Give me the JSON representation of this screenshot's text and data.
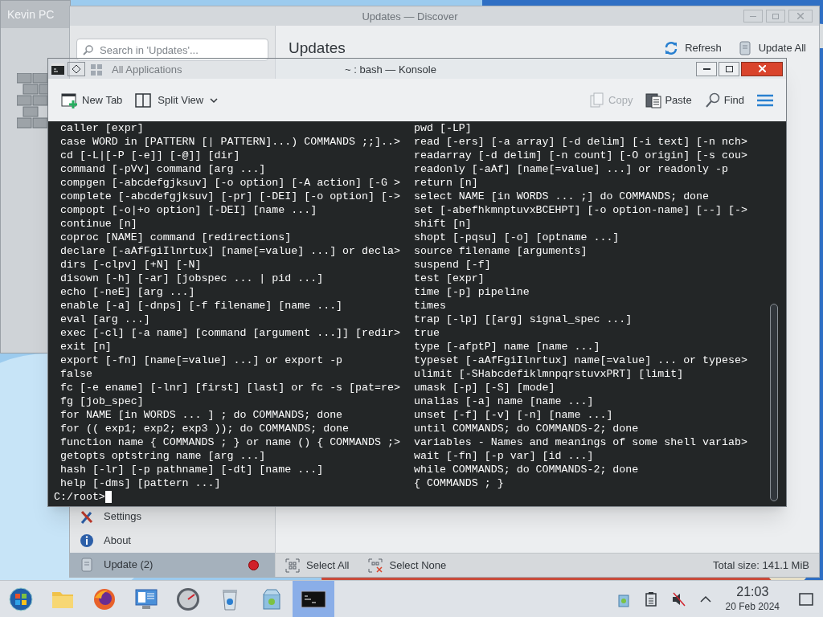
{
  "background_window": {
    "title": "Kevin PC"
  },
  "discover": {
    "title": "Updates — Discover",
    "search": {
      "placeholder": "Search in 'Updates'..."
    },
    "heading": "Updates",
    "actions": [
      {
        "kind": "refresh",
        "label": "Refresh"
      },
      {
        "kind": "update",
        "label": "Update All"
      }
    ],
    "sidebar": {
      "top_items": [
        {
          "kind": "apps",
          "label": "All Applications",
          "selected": false
        }
      ],
      "bottom_items": [
        {
          "kind": "settings",
          "label": "Settings",
          "selected": false
        },
        {
          "kind": "about",
          "label": "About",
          "selected": false
        },
        {
          "kind": "update",
          "label": "Update (2)",
          "selected": true,
          "alert": true
        }
      ]
    },
    "footer": {
      "buttons": [
        {
          "kind": "select-all",
          "label": "Select All"
        },
        {
          "kind": "select-none",
          "label": "Select None"
        }
      ],
      "total": "Total size: 141.1 MiB"
    }
  },
  "konsole": {
    "title": "~ : bash — Konsole",
    "toolbar_left": [
      {
        "kind": "new-tab",
        "label": "New Tab"
      },
      {
        "kind": "split",
        "label": "Split View"
      }
    ],
    "toolbar_right": [
      {
        "kind": "copy",
        "label": "Copy",
        "disabled": true
      },
      {
        "kind": "paste",
        "label": "Paste",
        "disabled": false
      },
      {
        "kind": "find",
        "label": "Find",
        "disabled": false
      }
    ],
    "lines_left": [
      "caller [expr]",
      "case WORD in [PATTERN [| PATTERN]...) COMMANDS ;;]..>",
      "cd [-L|[-P [-e]] [-@]] [dir]",
      "command [-pVv] command [arg ...]",
      "compgen [-abcdefgjksuv] [-o option] [-A action] [-G >",
      "complete [-abcdefgjksuv] [-pr] [-DEI] [-o option] [->",
      "compopt [-o|+o option] [-DEI] [name ...]",
      "continue [n]",
      "coproc [NAME] command [redirections]",
      "declare [-aAfFgiIlnrtux] [name[=value] ...] or decla>",
      "dirs [-clpv] [+N] [-N]",
      "disown [-h] [-ar] [jobspec ... | pid ...]",
      "echo [-neE] [arg ...]",
      "enable [-a] [-dnps] [-f filename] [name ...]",
      "eval [arg ...]",
      "exec [-cl] [-a name] [command [argument ...]] [redir>",
      "exit [n]",
      "export [-fn] [name[=value] ...] or export -p",
      "false",
      "fc [-e ename] [-lnr] [first] [last] or fc -s [pat=re>",
      "fg [job_spec]",
      "for NAME [in WORDS ... ] ; do COMMANDS; done",
      "for (( exp1; exp2; exp3 )); do COMMANDS; done",
      "function name { COMMANDS ; } or name () { COMMANDS ;>",
      "getopts optstring name [arg ...]",
      "hash [-lr] [-p pathname] [-dt] [name ...]",
      "help [-dms] [pattern ...]"
    ],
    "lines_right": [
      "pwd [-LP]",
      "read [-ers] [-a array] [-d delim] [-i text] [-n nch>",
      "readarray [-d delim] [-n count] [-O origin] [-s cou>",
      "readonly [-aAf] [name[=value] ...] or readonly -p",
      "return [n]",
      "select NAME [in WORDS ... ;] do COMMANDS; done",
      "set [-abefhkmnptuvxBCEHPT] [-o option-name] [--] [->",
      "shift [n]",
      "shopt [-pqsu] [-o] [optname ...]",
      "source filename [arguments]",
      "suspend [-f]",
      "test [expr]",
      "time [-p] pipeline",
      "times",
      "trap [-lp] [[arg] signal_spec ...]",
      "true",
      "type [-afptP] name [name ...]",
      "typeset [-aAfFgiIlnrtux] name[=value] ... or typese>",
      "ulimit [-SHabcdefiklmnpqrstuvxPRT] [limit]",
      "umask [-p] [-S] [mode]",
      "unalias [-a] name [name ...]",
      "unset [-f] [-v] [-n] [name ...]",
      "until COMMANDS; do COMMANDS-2; done",
      "variables - Names and meanings of some shell variab>",
      "wait [-fn] [-p var] [id ...]",
      "while COMMANDS; do COMMANDS-2; done",
      "{ COMMANDS ; }"
    ],
    "prompt": "C:/root>"
  },
  "taskbar": {
    "apps": [
      {
        "kind": "start",
        "active": false
      },
      {
        "kind": "folder",
        "active": false
      },
      {
        "kind": "browser",
        "active": false
      },
      {
        "kind": "monitor",
        "active": false
      },
      {
        "kind": "gauge",
        "active": false
      },
      {
        "kind": "trash",
        "active": false
      },
      {
        "kind": "store",
        "active": false
      },
      {
        "kind": "terminal",
        "active": true
      }
    ],
    "tray": [
      {
        "kind": "store"
      },
      {
        "kind": "clipboard"
      },
      {
        "kind": "muted"
      },
      {
        "kind": "caret"
      }
    ],
    "clock": {
      "time": "21:03",
      "date": "20 Feb 2024"
    }
  }
}
